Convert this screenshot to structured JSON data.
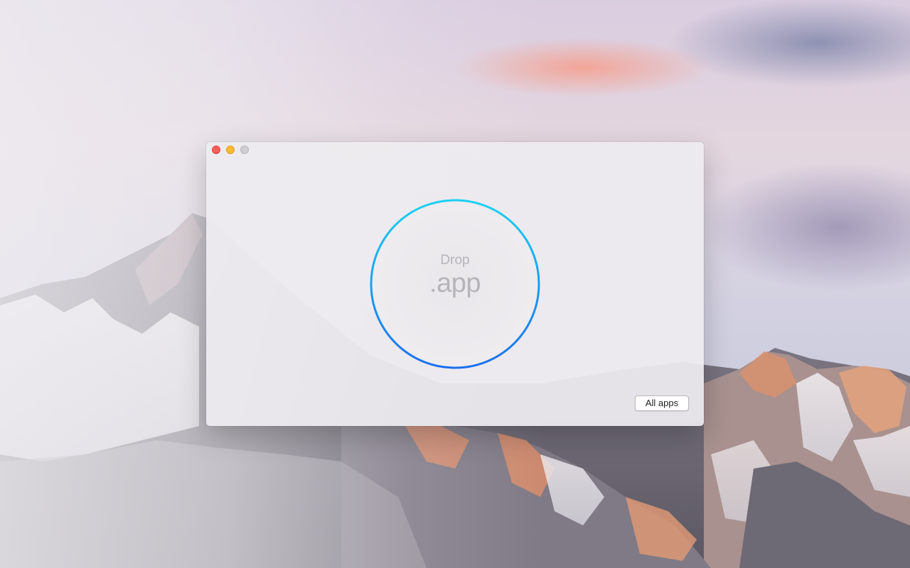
{
  "window": {
    "controls": {
      "close_color": "#fc5f57",
      "minimize_color": "#fdbc2e",
      "zoom_color": "#cfcdd0"
    }
  },
  "drop_zone": {
    "line1": "Drop",
    "line2": ".app",
    "ring_gradient": [
      "#1ad1f2",
      "#1a6ff0"
    ]
  },
  "footer": {
    "all_apps_label": "All apps"
  },
  "desktop": {
    "wallpaper": "mountain-sunset-wallpaper"
  }
}
